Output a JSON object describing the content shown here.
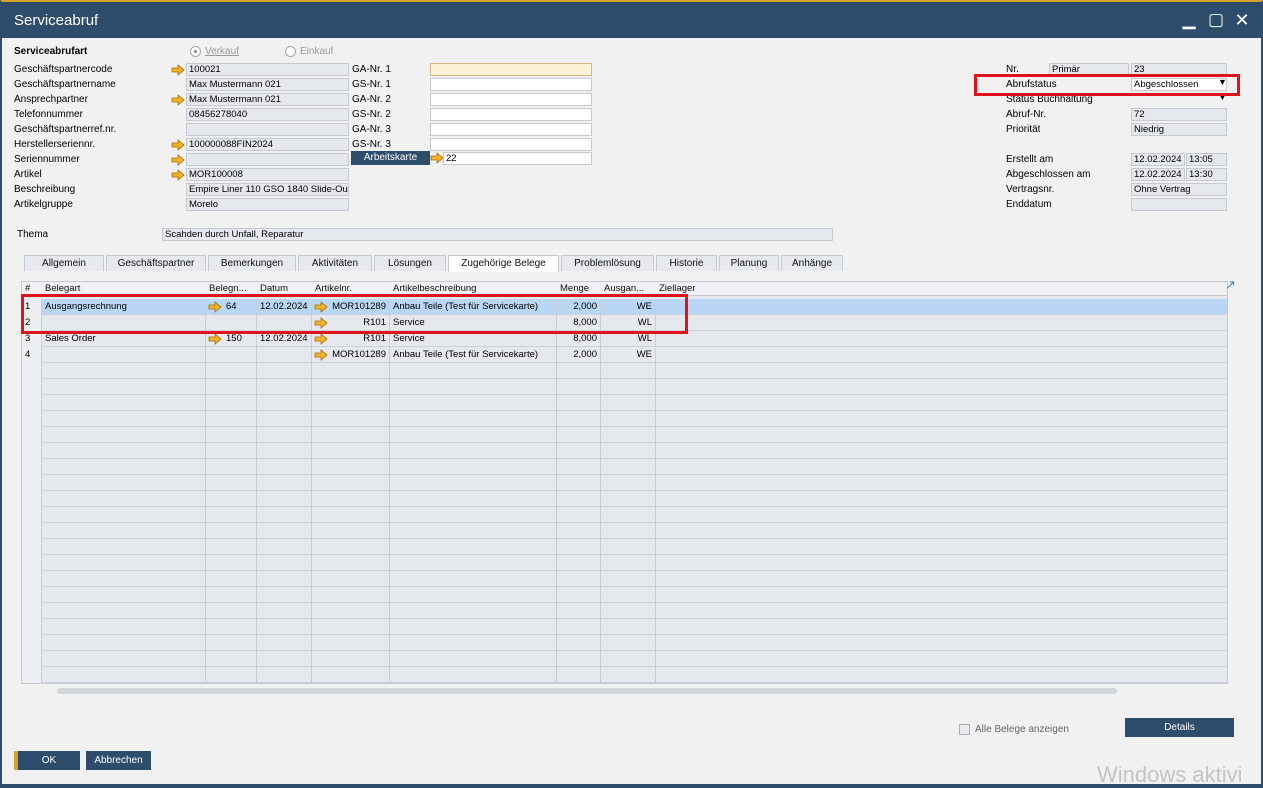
{
  "window": {
    "title": "Serviceabruf"
  },
  "header": {
    "type_label": "Serviceabrufart",
    "radio_verkauf": "Verkauf",
    "radio_einkauf": "Einkauf",
    "left_fields": [
      {
        "label": "Geschäftspartnercode",
        "value": "100021",
        "arrow": true
      },
      {
        "label": "Geschäftspartnername",
        "value": "Max Mustermann 021",
        "arrow": false
      },
      {
        "label": "Ansprechpartner",
        "value": "Max Mustermann 021",
        "arrow": true
      },
      {
        "label": "Telefonnummer",
        "value": "08456278040",
        "arrow": false
      },
      {
        "label": "Geschäftspartnerref.nr.",
        "value": "",
        "arrow": false
      },
      {
        "label": "Herstellerseriennr.",
        "value": "100000088FIN2024",
        "arrow": true
      },
      {
        "label": "Seriennummer",
        "value": "",
        "arrow": true
      },
      {
        "label": "Artikel",
        "value": "MOR100008",
        "arrow": true
      },
      {
        "label": "Beschreibung",
        "value": "Empire Liner 110 GSO 1840 Slide-Ou",
        "arrow": false
      },
      {
        "label": "Artikelgruppe",
        "value": "Morelo",
        "arrow": false
      }
    ],
    "mid_fields": [
      {
        "label": "GA-Nr. 1",
        "value": ""
      },
      {
        "label": "GS-Nr. 1",
        "value": ""
      },
      {
        "label": "GA-Nr. 2",
        "value": ""
      },
      {
        "label": "GS-Nr. 2",
        "value": ""
      },
      {
        "label": "GA-Nr. 3",
        "value": ""
      },
      {
        "label": "GS-Nr. 3",
        "value": ""
      }
    ],
    "arbeitskarte_label": "Arbeitskarte",
    "arbeitskarte_value": "22",
    "right": {
      "nr_label": "Nr.",
      "nr_series": "Primär",
      "nr_value": "23",
      "abrufstatus_label": "Abrufstatus",
      "abrufstatus_value": "Abgeschlossen",
      "status_buchhaltung_label": "Status Buchhaltung",
      "abruf_nr_label": "Abruf-Nr.",
      "abruf_nr_value": "72",
      "prioritaet_label": "Priorität",
      "prioritaet_value": "Niedrig",
      "erstellt_label": "Erstellt am",
      "erstellt_date": "12.02.2024",
      "erstellt_time": "13:05",
      "abgeschlossen_label": "Abgeschlossen am",
      "abgeschlossen_date": "12.02.2024",
      "abgeschlossen_time": "13:30",
      "vertragsnr_label": "Vertragsnr.",
      "vertragsnr_value": "Ohne Vertrag",
      "enddatum_label": "Enddatum",
      "enddatum_value": ""
    },
    "thema_label": "Thema",
    "thema_value": "Scahden durch Unfall, Reparatur"
  },
  "tabs": [
    "Allgemein",
    "Geschäftspartner",
    "Bemerkungen",
    "Aktivitäten",
    "Lösungen",
    "Zugehörige Belege",
    "Problemlösung",
    "Historie",
    "Planung",
    "Anhänge"
  ],
  "active_tab": "Zugehörige Belege",
  "grid": {
    "columns": [
      "#",
      "Belegart",
      "Belegn...",
      "Datum",
      "Artikelnr.",
      "Artikelbeschreibung",
      "Menge",
      "Ausgan...",
      "Ziellager"
    ],
    "rows": [
      {
        "num": "1",
        "belegart": "Ausgangsrechnung",
        "belegnr": "64",
        "datum": "12.02.2024",
        "artikelnr": "MOR101289",
        "beschreibung": "Anbau Teile (Test für Servicekarte)",
        "menge": "2,000",
        "ausgang": "WE",
        "ziellager": ""
      },
      {
        "num": "2",
        "belegart": "",
        "belegnr": "",
        "datum": "",
        "artikelnr": "R101",
        "beschreibung": "Service",
        "menge": "8,000",
        "ausgang": "WL",
        "ziellager": ""
      },
      {
        "num": "3",
        "belegart": "Sales Order",
        "belegnr": "150",
        "datum": "12.02.2024",
        "artikelnr": "R101",
        "beschreibung": "Service",
        "menge": "8,000",
        "ausgang": "WL",
        "ziellager": ""
      },
      {
        "num": "4",
        "belegart": "",
        "belegnr": "",
        "datum": "",
        "artikelnr": "MOR101289",
        "beschreibung": "Anbau Teile (Test für Servicekarte)",
        "menge": "2,000",
        "ausgang": "WE",
        "ziellager": ""
      }
    ]
  },
  "footer": {
    "alle_belege_label": "Alle Belege anzeigen",
    "details_label": "Details",
    "ok_label": "OK",
    "abbrechen_label": "Abbrechen"
  },
  "watermark": "Windows aktivi"
}
